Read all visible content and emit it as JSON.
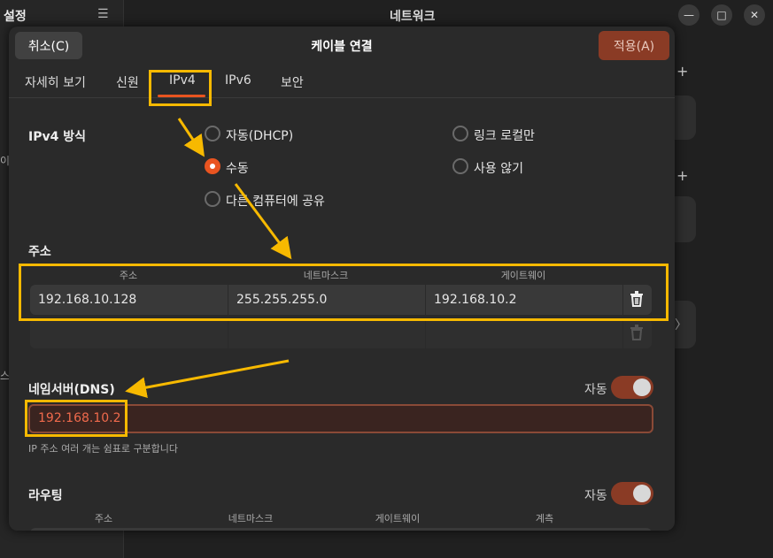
{
  "background": {
    "sidebar_title": "설정",
    "menu_icon": "☰",
    "side_fragment_1": "이",
    "side_fragment_2": "스",
    "main_title": "네트워크",
    "window_buttons": [
      "—",
      "□",
      "✕"
    ],
    "add_icons": [
      "+",
      "+"
    ],
    "chevron": "〉"
  },
  "dialog": {
    "cancel_label": "취소(C)",
    "title": "케이블 연결",
    "apply_label": "적용(A)",
    "accent_color": "#e95420"
  },
  "tabs": [
    {
      "label": "자세히 보기"
    },
    {
      "label": "신원"
    },
    {
      "label": "IPv4"
    },
    {
      "label": "IPv6"
    },
    {
      "label": "보안"
    }
  ],
  "active_tab": "IPv4",
  "ipv4": {
    "method_label": "IPv4 방식",
    "methods": [
      {
        "label": "자동(DHCP)",
        "selected": false
      },
      {
        "label": "수동",
        "selected": true
      },
      {
        "label": "다른 컴퓨터에 공유",
        "selected": false
      },
      {
        "label": "링크 로컬만",
        "selected": false
      },
      {
        "label": "사용 않기",
        "selected": false
      }
    ]
  },
  "address": {
    "section_label": "주소",
    "columns": [
      "주소",
      "네트마스크",
      "게이트웨이"
    ],
    "rows": [
      {
        "address": "192.168.10.128",
        "netmask": "255.255.255.0",
        "gateway": "192.168.10.2"
      }
    ]
  },
  "dns": {
    "label": "네임서버(DNS)",
    "auto_label": "자동",
    "auto_enabled": true,
    "value": "192.168.10.2",
    "hint": "IP 주소 여러 개는 쉼표로 구분합니다"
  },
  "routing": {
    "label": "라우팅",
    "auto_label": "자동",
    "auto_enabled": true,
    "columns": [
      "주소",
      "네트마스크",
      "게이트웨이",
      "계측"
    ]
  },
  "annotation_color": "#f7b900"
}
